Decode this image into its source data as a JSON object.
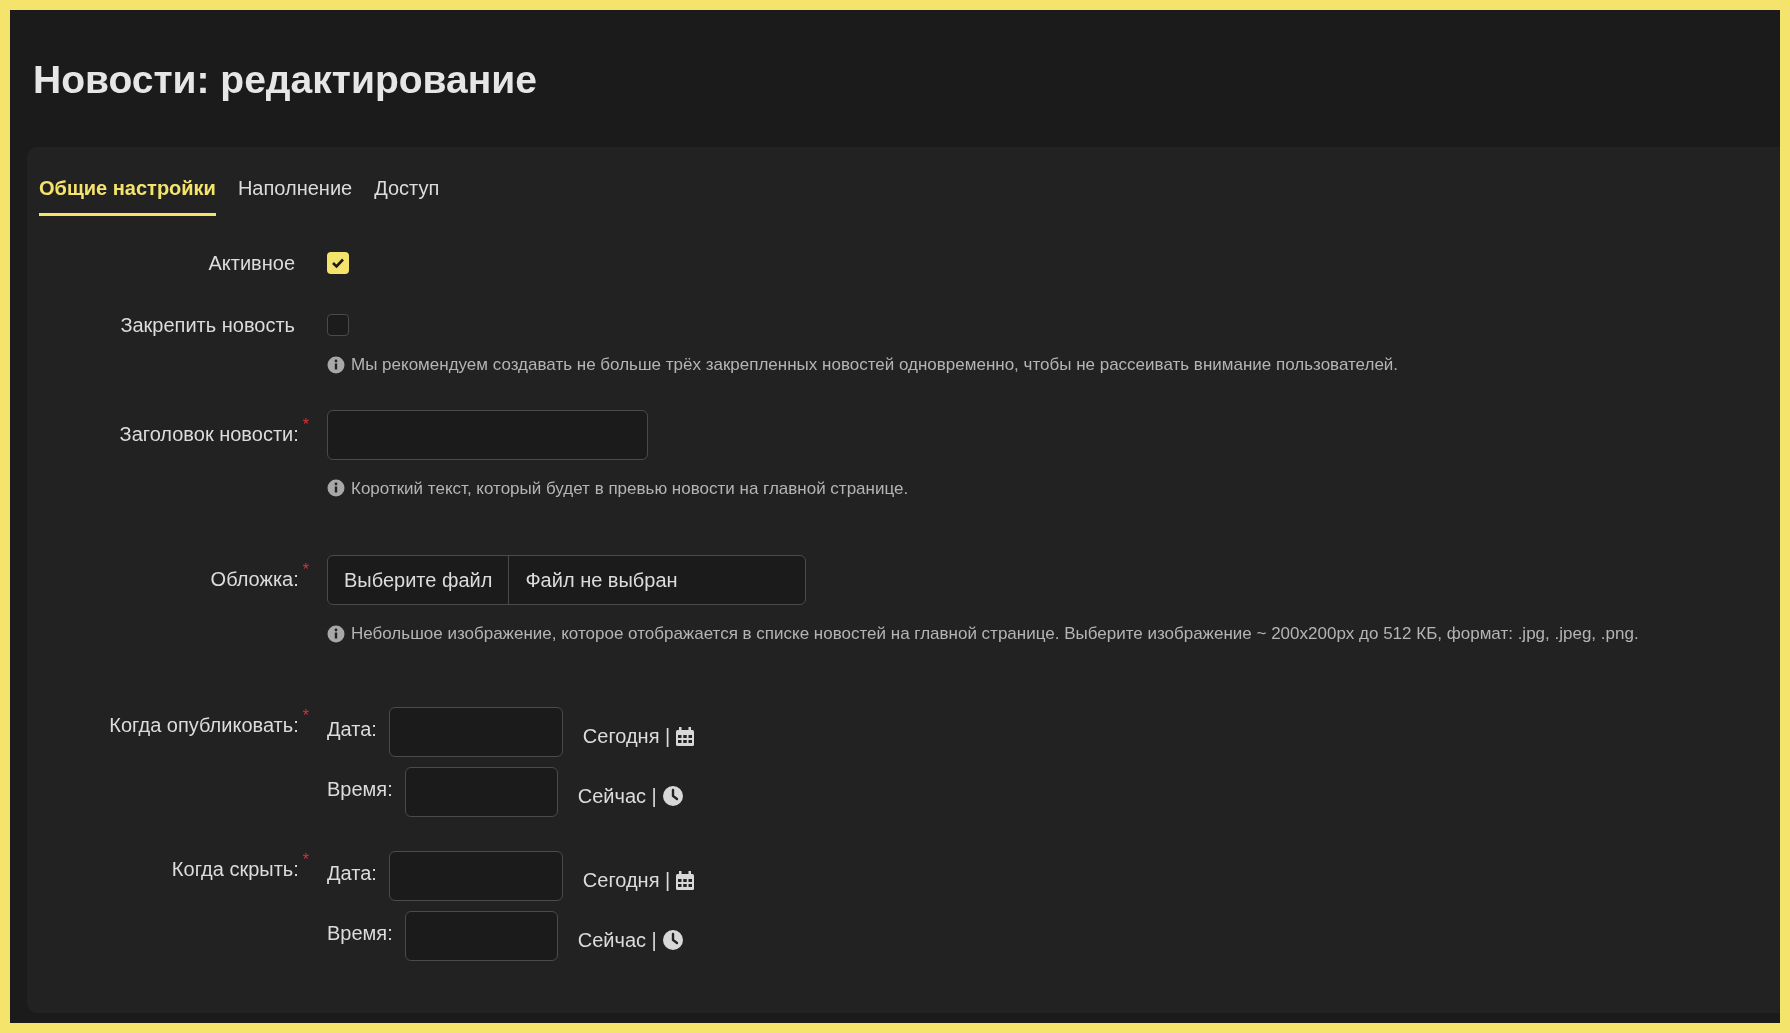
{
  "title": "Новости: редактирование",
  "tabs": [
    {
      "label": "Общие настройки",
      "selected": true
    },
    {
      "label": "Наполнение",
      "selected": false
    },
    {
      "label": "Доступ",
      "selected": false
    }
  ],
  "fields": [
    {
      "kind": "checkbox",
      "label": "Активное",
      "checked": true
    },
    {
      "kind": "checkbox",
      "label": "Закрепить новость",
      "checked": false,
      "hint": "Мы рекомендуем создавать не больше трёх закрепленных новостей одновременно, чтобы не рассеивать внимание пользователей."
    },
    {
      "kind": "text",
      "label": "Заголовок новости:",
      "required_mark": "*",
      "hint": "Короткий текст, который будет в превью новости на главной странице."
    },
    {
      "kind": "file",
      "label": "Обложка:",
      "required_mark": "*",
      "button": "Выберите файл",
      "value": "Файл не выбран",
      "hint": "Небольшое изображение, которое отображается в списке новостей на главной странице. Выберите изображение ~ 200x200px до 512 КБ, формат: .jpg, .jpeg, .png."
    },
    {
      "kind": "datetime",
      "label": "Когда опубликовать:",
      "required_mark": "*",
      "date_label": "Дата:",
      "date_link": "Сегодня |",
      "time_label": "Время:",
      "time_link": "Сейчас |"
    },
    {
      "kind": "datetime",
      "label": "Когда скрыть:",
      "required_mark": "*",
      "date_label": "Дата:",
      "date_link": "Сегодня |",
      "time_label": "Время:",
      "time_link": "Сейчас |"
    }
  ]
}
